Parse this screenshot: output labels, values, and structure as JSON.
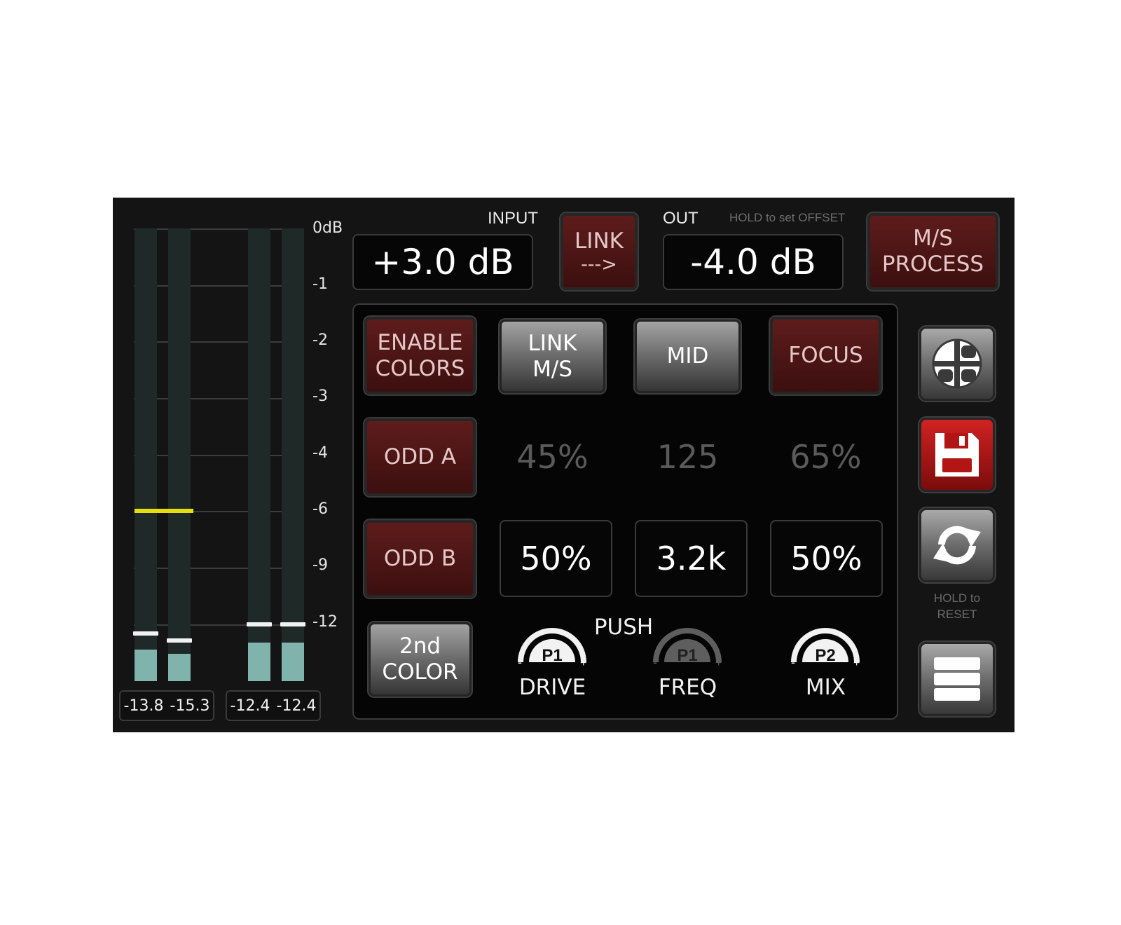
{
  "colors": {
    "accent_red": "#5e1c1c",
    "meter_fill": "#7fb3ab",
    "hold_line": "#e6df10",
    "save_red": "#d12222"
  },
  "meters": {
    "scale": [
      "0dB",
      "-1",
      "-2",
      "-3",
      "-4",
      "-6",
      "-9",
      "-12"
    ],
    "channels": [
      {
        "readout": "-13.8",
        "level": 0.07,
        "peak": 0.1
      },
      {
        "readout": "-15.3",
        "level": 0.06,
        "peak": 0.085
      },
      {
        "readout": "-12.4",
        "level": 0.085,
        "peak": 0.12
      },
      {
        "readout": "-12.4",
        "level": 0.085,
        "peak": 0.12
      }
    ]
  },
  "input": {
    "label": "INPUT",
    "value": "+3.0 dB"
  },
  "link_button": {
    "line1": "LINK",
    "line2": "--->"
  },
  "output": {
    "label": "OUT",
    "hint": "HOLD to set OFFSET",
    "value": "-4.0 dB"
  },
  "ms_process": {
    "line1": "M/S",
    "line2": "PROCESS"
  },
  "grid": {
    "enable_colors": {
      "line1": "ENABLE",
      "line2": "COLORS"
    },
    "link_ms": {
      "line1": "LINK",
      "line2": "M/S"
    },
    "mid": "MID",
    "focus": "FOCUS",
    "odd_a": "ODD A",
    "odd_a_values": [
      "45%",
      "125",
      "65%"
    ],
    "odd_b": "ODD B",
    "odd_b_values": [
      "50%",
      "3.2k",
      "50%"
    ],
    "second_color": {
      "line1": "2nd",
      "line2": "COLOR"
    },
    "push_label": "PUSH",
    "knobs": [
      {
        "tag": "P1",
        "label": "DRIVE",
        "minus": "-",
        "plus": "+"
      },
      {
        "tag": "P1",
        "label": "FREQ",
        "minus": "-",
        "plus": "+"
      },
      {
        "tag": "P2",
        "label": "MIX",
        "minus": "-",
        "plus": "+"
      }
    ]
  },
  "side": {
    "icons": [
      "quadrant-icon",
      "floppy-disk-icon",
      "refresh-icon",
      "menu-icon"
    ],
    "hold_reset_line1": "HOLD to",
    "hold_reset_line2": "RESET"
  }
}
